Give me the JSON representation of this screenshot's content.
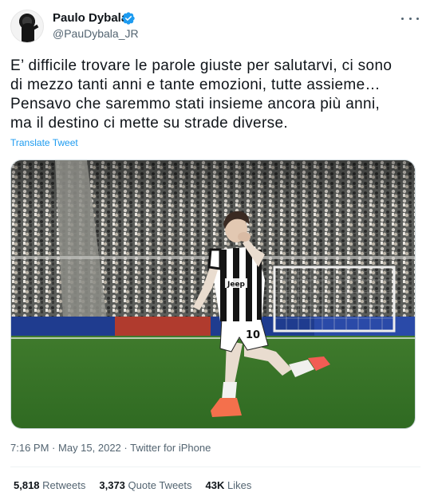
{
  "author": {
    "name": "Paulo Dybala",
    "handle": "@PauDybala_JR",
    "verified_color": "#1d9bf0"
  },
  "tweet": {
    "lines": [
      "E’ difficile trovare le parole giuste per salutarvi, ci sono",
      "di mezzo tanti anni e tante emozioni, tutte assieme…",
      "Pensavo che saremmo stati insieme ancora più anni,",
      "ma il destino ci mette su strade diverse."
    ],
    "translate_label": "Translate Tweet",
    "time": "7:16 PM",
    "date": "May 15, 2022",
    "source": "Twitter for iPhone",
    "separator": "·"
  },
  "media": {
    "shirt_number": "10",
    "sponsor": "Jeep"
  },
  "stats": [
    {
      "count": "5,818",
      "label": "Retweets"
    },
    {
      "count": "3,373",
      "label": "Quote Tweets"
    },
    {
      "count": "43K",
      "label": "Likes"
    }
  ],
  "icons": {
    "more": "more-icon",
    "verified": "verified-badge-icon"
  },
  "colors": {
    "accent": "#1d9bf0",
    "text": "#0f1419",
    "secondary": "#536471"
  }
}
